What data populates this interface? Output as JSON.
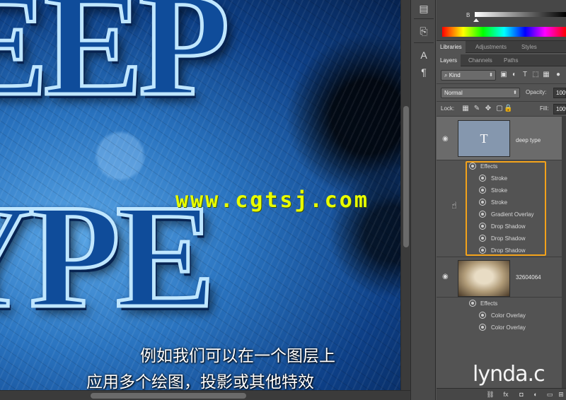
{
  "canvas": {
    "line1": "EEP",
    "line2": "YPE",
    "watermark": "www.cgtsj.com",
    "subtitle_line1": "例如我们可以在一个图层上",
    "subtitle_line2": "应用多个绘图，投影或其他特效"
  },
  "color_panel": {
    "slider_label": "B",
    "slider_value_fraction": 0.0
  },
  "tabs_top": [
    {
      "label": "Libraries",
      "active": true
    },
    {
      "label": "Adjustments",
      "active": false
    },
    {
      "label": "Styles",
      "active": false
    }
  ],
  "tabs_layers": [
    {
      "label": "Layers",
      "active": true
    },
    {
      "label": "Channels",
      "active": false
    },
    {
      "label": "Paths",
      "active": false
    }
  ],
  "filter": {
    "kind_label": "Kind"
  },
  "blend": {
    "mode": "Normal",
    "opacity_label": "Opacity:",
    "opacity_value": "100%"
  },
  "lock": {
    "label": "Lock:",
    "fill_label": "Fill:",
    "fill_value": "100%"
  },
  "layers": [
    {
      "name": "deep type",
      "thumb_glyph": "T",
      "effects_label": "Effects",
      "effects": [
        "Stroke",
        "Stroke",
        "Stroke",
        "Gradient Overlay",
        "Drop Shadow",
        "Drop Shadow",
        "Drop Shadow"
      ]
    },
    {
      "name": "32604064",
      "effects_label": "Effects",
      "effects": [
        "Color Overlay",
        "Color Overlay"
      ]
    }
  ],
  "bottom_bar": {
    "fx_label": "fx"
  },
  "brand": "lynda.c",
  "colors": {
    "highlight": "#f3a21a",
    "watermark": "#e8ff00",
    "panel_bg": "#535353"
  }
}
